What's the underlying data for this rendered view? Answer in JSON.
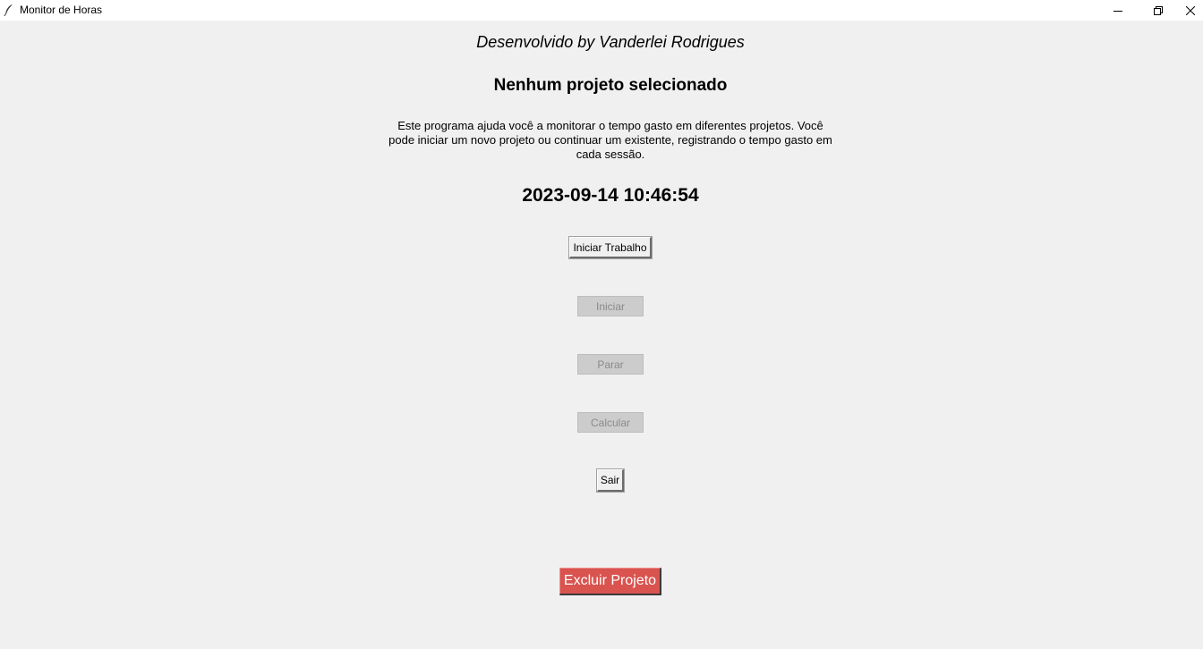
{
  "window": {
    "title": "Monitor de Horas",
    "icon": "feather-icon"
  },
  "main": {
    "credit": "Desenvolvido by Vanderlei Rodrigues",
    "project_title": "Nenhum projeto selecionado",
    "description": "Este programa ajuda você a monitorar o tempo gasto em diferentes projetos. Você pode iniciar um novo projeto ou continuar um existente, registrando o tempo gasto em cada sessão.",
    "datetime": "2023-09-14 10:46:54"
  },
  "buttons": {
    "start_work": "Iniciar Trabalho",
    "start": "Iniciar",
    "stop": "Parar",
    "calculate": "Calcular",
    "exit": "Sair",
    "delete_project": "Excluir Projeto"
  },
  "colors": {
    "background": "#f0f0f0",
    "disabled_button": "#cccccc",
    "delete_button": "#d9534f"
  }
}
